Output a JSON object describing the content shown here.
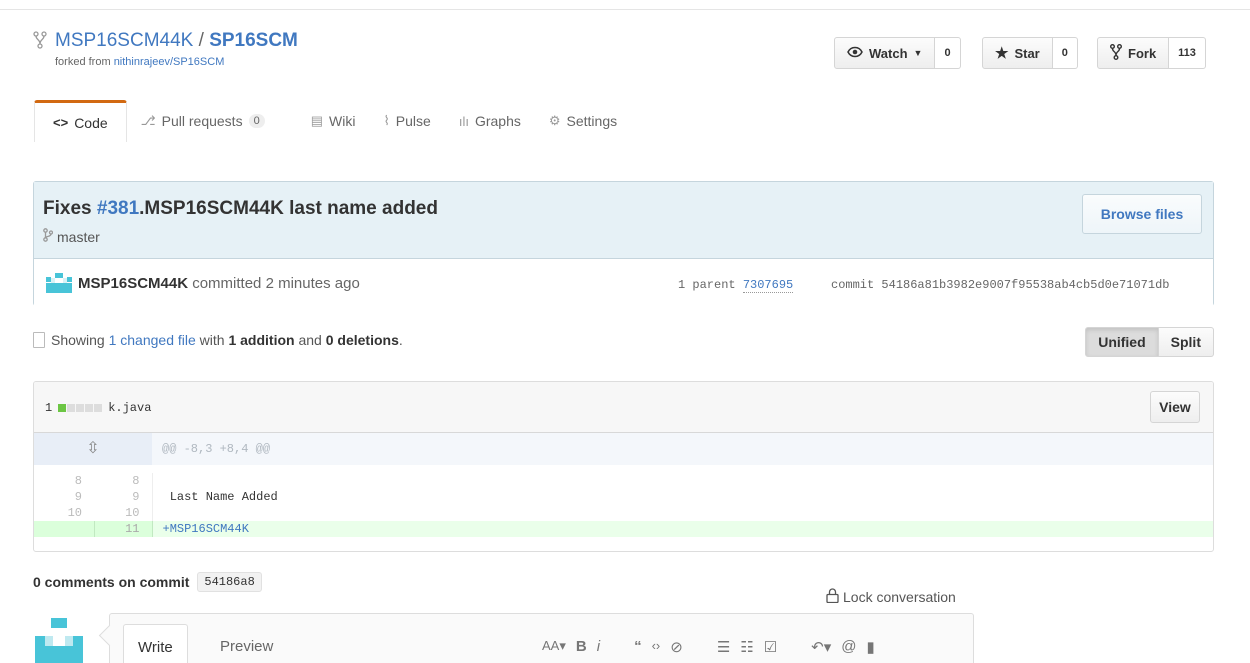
{
  "repo": {
    "owner": "MSP16SCM44K",
    "separator": " / ",
    "name": "SP16SCM",
    "forked_from_label": "forked from ",
    "forked_from_link": "nithinrajeev/SP16SCM"
  },
  "actions": {
    "watch_label": "Watch",
    "watch_count": "0",
    "star_label": "Star",
    "star_count": "0",
    "fork_label": "Fork",
    "fork_count": "113"
  },
  "tabs": [
    {
      "label": "Code"
    },
    {
      "label": "Pull requests",
      "counter": "0"
    },
    {
      "label": "Wiki"
    },
    {
      "label": "Pulse"
    },
    {
      "label": "Graphs"
    },
    {
      "label": "Settings"
    }
  ],
  "commit": {
    "title_prefix": "Fixes ",
    "issue": "#381",
    "title_rest": ".MSP16SCM44K last name added",
    "branch": "master",
    "browse_label": "Browse files",
    "author": "MSP16SCM44K",
    "committed_text": " committed 2 minutes ago",
    "parent_label": "1 parent ",
    "parent_sha": "7307695",
    "commit_label": "commit ",
    "commit_sha": "54186a81b3982e9007f95538ab4cb5d0e71071db"
  },
  "toc": {
    "showing": "Showing ",
    "changed_link": "1 changed file",
    "with": " with ",
    "additions": "1 addition",
    "and": " and ",
    "deletions": "0 deletions",
    "period": ".",
    "unified_label": "Unified",
    "split_label": "Split"
  },
  "file": {
    "change_count": "1",
    "filename": "k.java",
    "view_label": "View",
    "hunk_header": "@@ -8,3 +8,4 @@",
    "lines": [
      {
        "old": "8",
        "new": "8",
        "text": ""
      },
      {
        "old": "9",
        "new": "9",
        "text": " Last Name Added"
      },
      {
        "old": "10",
        "new": "10",
        "text": ""
      }
    ],
    "added_line": {
      "new": "11",
      "text": "+MSP16SCM44K"
    }
  },
  "comments": {
    "heading": "0 comments on commit",
    "short_sha": "54186a8",
    "lock_label": "Lock conversation"
  },
  "editor": {
    "write_label": "Write",
    "preview_label": "Preview"
  },
  "colors": {
    "accent": "#4078c0",
    "tab_active": "#d26911",
    "addition": "#6cc644",
    "commit_bg": "#e6f1f6"
  }
}
